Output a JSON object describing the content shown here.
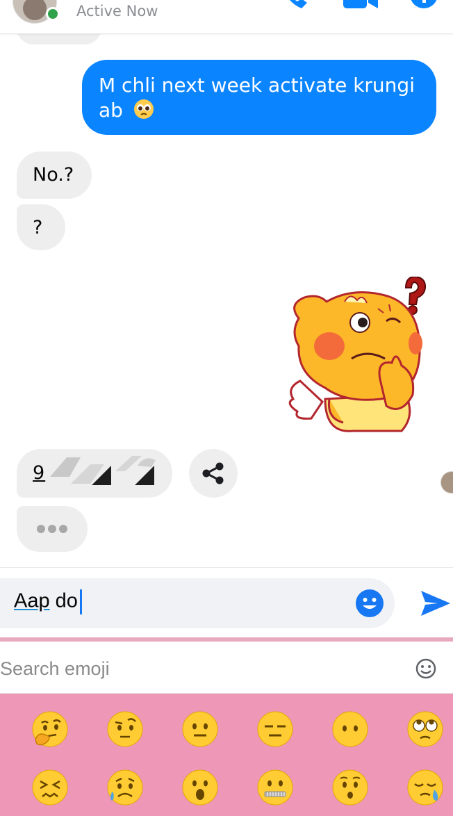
{
  "header": {
    "status_text": "Active Now",
    "presence_color": "#31a24c",
    "icons": [
      "phone-icon",
      "video-icon",
      "info-icon"
    ]
  },
  "messages": [
    {
      "direction": "outgoing",
      "text_line1": "M chli next week activate krungi",
      "text_line2": "ab",
      "emoji": "pleading-face"
    },
    {
      "direction": "incoming",
      "text": "No.?"
    },
    {
      "direction": "incoming",
      "text": "?"
    },
    {
      "direction": "outgoing",
      "type": "sticker",
      "sticker": "thinking-yellow-creature-with-question-mark"
    },
    {
      "direction": "incoming",
      "type": "link",
      "text": "9"
    },
    {
      "direction": "incoming",
      "type": "typing-indicator"
    }
  ],
  "composer": {
    "value_word1": "Aap",
    "value_word2": "do",
    "accent_color": "#1877f2"
  },
  "emoji_search": {
    "placeholder": "Search emoji"
  },
  "emoji_grid": {
    "row1": [
      "thinking-face",
      "face-with-raised-eyebrow",
      "neutral-face",
      "expressionless-face",
      "face-without-mouth",
      "face-with-rolling-eyes"
    ],
    "row2": [
      "confounded-face",
      "sad-but-relieved-face",
      "face-with-open-mouth",
      "zipper-mouth-face",
      "hushed-face",
      "sleepy-face"
    ]
  },
  "colors": {
    "outgoing_bubble": "#0a84ff",
    "incoming_bubble": "#eeeeee",
    "emoji_panel_bg": "#ef97b6"
  }
}
